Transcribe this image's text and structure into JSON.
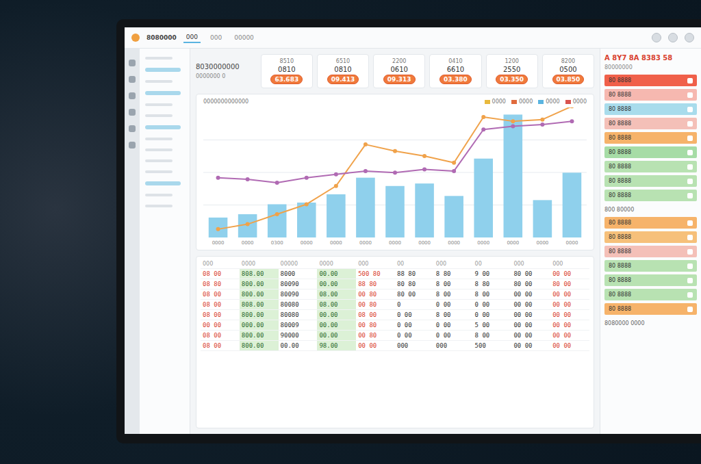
{
  "window": {
    "title": "8080000"
  },
  "topbar": {
    "tabs": [
      {
        "label": "000",
        "selected": true
      },
      {
        "label": "000",
        "selected": false
      },
      {
        "label": "00000",
        "selected": false
      }
    ]
  },
  "sidebar": {
    "items": [
      {
        "kind": "line"
      },
      {
        "kind": "bar"
      },
      {
        "kind": "line"
      },
      {
        "kind": "bar"
      },
      {
        "kind": "line"
      },
      {
        "kind": "line"
      },
      {
        "kind": "bar"
      },
      {
        "kind": "line"
      },
      {
        "kind": "line"
      },
      {
        "kind": "line"
      },
      {
        "kind": "line"
      },
      {
        "kind": "bar"
      },
      {
        "kind": "line"
      },
      {
        "kind": "line"
      }
    ]
  },
  "header": {
    "title": "8030000000",
    "subtitle": "0000000 0"
  },
  "kpis": [
    {
      "label": "8510",
      "value": "0810",
      "pill": "63.683"
    },
    {
      "label": "6510",
      "value": "0810",
      "pill": "09.413"
    },
    {
      "label": "2200",
      "value": "0610",
      "pill": "09.313"
    },
    {
      "label": "0410",
      "value": "6610",
      "pill": "03.380"
    },
    {
      "label": "1200",
      "value": "2550",
      "pill": "03.350"
    },
    {
      "label": "8200",
      "value": "0500",
      "pill": "03.850"
    }
  ],
  "chart": {
    "title": "0000000000000",
    "legend": [
      {
        "label": "0000",
        "color": "#e8b93c"
      },
      {
        "label": "0000",
        "color": "#e06a3c"
      },
      {
        "label": "0000",
        "color": "#5ab4e0"
      },
      {
        "label": "0000",
        "color": "#d9534f"
      }
    ],
    "max": 150,
    "bars": {
      "color": "#8fd0ec",
      "values": [
        24,
        28,
        40,
        42,
        52,
        72,
        62,
        65,
        50,
        95,
        148,
        45,
        78
      ]
    },
    "lines": [
      {
        "color": "#f0a24a",
        "values": [
          10,
          16,
          28,
          40,
          62,
          112,
          104,
          98,
          90,
          145,
          140,
          142,
          158
        ]
      },
      {
        "color": "#b06ab3",
        "values": [
          72,
          70,
          66,
          72,
          76,
          80,
          78,
          82,
          80,
          130,
          134,
          136,
          140
        ]
      }
    ],
    "x_labels": [
      "0000",
      "0000",
      "0300",
      "0000",
      "0000",
      "0000",
      "0000",
      "0000",
      "0000",
      "0000",
      "0000",
      "0000",
      "0000"
    ]
  },
  "table": {
    "columns": [
      {
        "label": "000",
        "tone": "red"
      },
      {
        "label": "0000",
        "tone": "green"
      },
      {
        "label": "00000",
        "tone": "plain"
      },
      {
        "label": "0000",
        "tone": "green"
      },
      {
        "label": "000",
        "tone": "red"
      },
      {
        "label": "00",
        "tone": "plain"
      },
      {
        "label": "000",
        "tone": "plain"
      },
      {
        "label": "00",
        "tone": "plain"
      },
      {
        "label": "000",
        "tone": "plain"
      },
      {
        "label": "000",
        "tone": "red"
      }
    ],
    "rows": [
      [
        "08 00",
        "808.00",
        "8000",
        "00.00",
        "500 80",
        "88 80",
        "8 80",
        "9 00",
        "80 00",
        "00 00"
      ],
      [
        "08 80",
        "800.00",
        "80090",
        "00.00",
        "88 80",
        "80 80",
        "8 00",
        "8 80",
        "80 00",
        "80 00"
      ],
      [
        "08 00",
        "800.00",
        "80090",
        "08.00",
        "00 80",
        "80 00",
        "8 00",
        "8 00",
        "00 00",
        "00 00"
      ],
      [
        "08 00",
        "808.00",
        "80080",
        "08.00",
        "00 80",
        "0",
        "0 00",
        "0 00",
        "00 00",
        "00 00"
      ],
      [
        "08 00",
        "800.00",
        "80080",
        "00.00",
        "08 00",
        "0 00",
        "8 00",
        "0 00",
        "00 00",
        "00 00"
      ],
      [
        "00 00",
        "000.00",
        "80009",
        "00.00",
        "00 80",
        "0 00",
        "0 00",
        "5 00",
        "00 00",
        "00 00"
      ],
      [
        "08 00",
        "800.00",
        "90000",
        "00.00",
        "00 80",
        "0 00",
        "0 00",
        "8 00",
        "00 00",
        "00 00"
      ],
      [
        "08 00",
        "800.00",
        "00.00",
        "98.00",
        "00 00",
        "000",
        "000",
        "500",
        "00 00",
        "00 00"
      ]
    ]
  },
  "right_panel": {
    "title": "A 8Y7 8A 8383 58",
    "subtitle": "80000000",
    "items": [
      {
        "label": "80 8888",
        "color": "#f0604a"
      },
      {
        "label": "80 8888",
        "color": "#f6b8b0"
      },
      {
        "label": "80 8888",
        "color": "#a8dcec"
      },
      {
        "label": "80 8888",
        "color": "#f4c0b8"
      },
      {
        "label": "80 8888",
        "color": "#f6b36a"
      },
      {
        "label": "80 8888",
        "color": "#a6dca6"
      },
      {
        "label": "80 8888",
        "color": "#b8e2b2"
      },
      {
        "label": "80 8888",
        "color": "#b8e2b2"
      },
      {
        "label": "80 8888",
        "color": "#b8e2b2"
      }
    ],
    "section": "800 80000",
    "items2": [
      {
        "label": "80 8888",
        "color": "#f6b36a"
      },
      {
        "label": "80 8888",
        "color": "#f6c07a"
      },
      {
        "label": "80 8888",
        "color": "#f4c0b8"
      },
      {
        "label": "80 8888",
        "color": "#b8e2b2"
      },
      {
        "label": "80 8888",
        "color": "#b8e2b2"
      },
      {
        "label": "80 8888",
        "color": "#b8e2b2"
      },
      {
        "label": "80 8888",
        "color": "#f6b36a"
      }
    ],
    "footer": "8080000 0000"
  }
}
